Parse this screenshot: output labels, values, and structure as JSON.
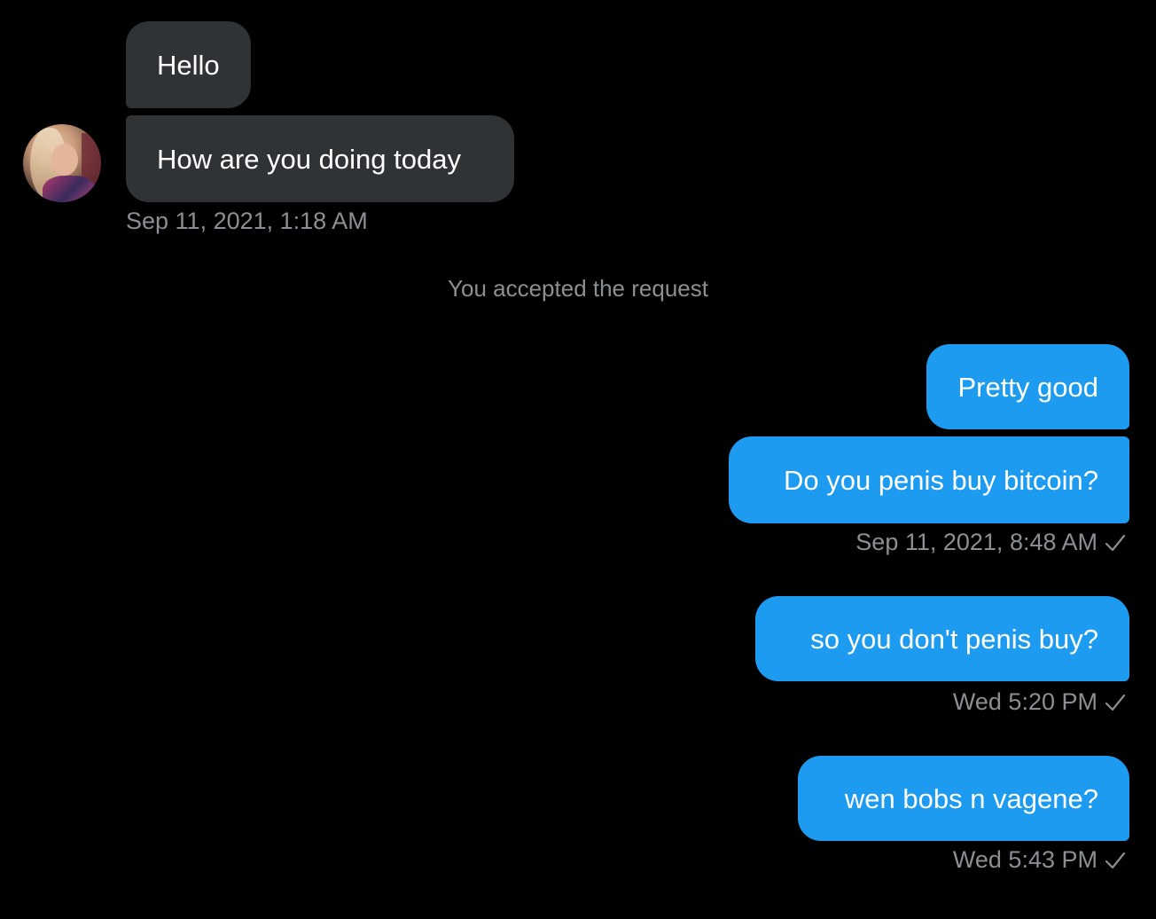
{
  "conversation": {
    "incoming": [
      {
        "text": "Hello"
      },
      {
        "text": "How are you doing today"
      }
    ],
    "incoming_timestamp": "Sep 11, 2021, 1:18 AM",
    "system_message": "You accepted the request",
    "outgoing": [
      {
        "text": "Pretty good"
      },
      {
        "text": "Do you penis buy bitcoin?"
      },
      {
        "text": "so you don't penis buy?"
      },
      {
        "text": "wen bobs n vagene?"
      }
    ],
    "outgoing_timestamps": [
      "Sep 11, 2021, 8:48 AM",
      "Wed 5:20 PM",
      "Wed 5:43 PM"
    ]
  },
  "colors": {
    "background": "#000000",
    "incoming_bubble": "#2f3336",
    "outgoing_bubble": "#1d9bf0",
    "timestamp": "#8b8f94"
  },
  "icons": {
    "sent_status": "check-icon",
    "avatar": "avatar-photo"
  }
}
